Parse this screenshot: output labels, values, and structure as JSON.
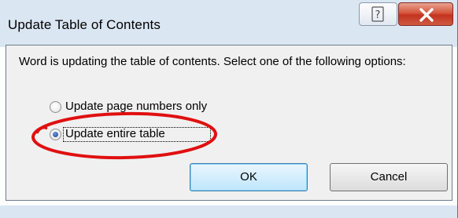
{
  "window": {
    "title": "Update Table of Contents",
    "help_glyph": "?",
    "close_glyph": "X"
  },
  "message": "Word is updating the table of contents.  Select one of the following options:",
  "options": [
    {
      "label": "Update page numbers only",
      "selected": false
    },
    {
      "label": "Update entire table",
      "selected": true
    }
  ],
  "buttons": {
    "ok": "OK",
    "cancel": "Cancel"
  },
  "colors": {
    "title_bar": "#dbe6f3",
    "close_button": "#c3331f",
    "annotation_ellipse": "#e01010"
  },
  "annotation": {
    "shape": "ellipse",
    "highlights": "Update entire table"
  }
}
